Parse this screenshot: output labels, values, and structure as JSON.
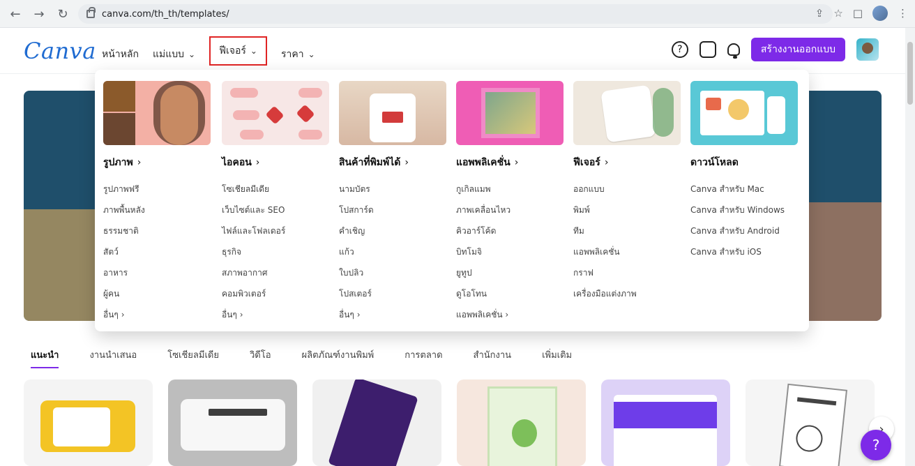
{
  "browser": {
    "url": "canva.com/th_th/templates/",
    "back_icon": "←",
    "forward_icon": "→",
    "refresh_icon": "↻",
    "share_icon": "⇪",
    "star_icon": "☆",
    "window_icon": "□",
    "menu_icon": "⋮"
  },
  "header": {
    "logo": "Canva",
    "nav": [
      {
        "label": "หน้าหลัก",
        "has_chevron": false
      },
      {
        "label": "แม่แบบ",
        "has_chevron": true
      },
      {
        "label": "ฟีเจอร์",
        "has_chevron": true,
        "active": true
      },
      {
        "label": "ราคา",
        "has_chevron": true
      }
    ],
    "help_icon": "?",
    "create_label": "สร้างงานออกแบบ"
  },
  "mega_menu": {
    "columns": [
      {
        "title": "รูปภาพ",
        "links": [
          "รูปภาพฟรี",
          "ภาพพื้นหลัง",
          "ธรรมชาติ",
          "สัตว์",
          "อาหาร",
          "ผู้คน",
          "อื่นๆ"
        ]
      },
      {
        "title": "ไอคอน",
        "links": [
          "โซเชียลมีเดีย",
          "เว็บไซต์และ SEO",
          "ไฟล์และโฟลเดอร์",
          "ธุรกิจ",
          "สภาพอากาศ",
          "คอมพิวเตอร์",
          "อื่นๆ"
        ]
      },
      {
        "title": "สินค้าที่พิมพ์ได้",
        "links": [
          "นามบัตร",
          "โปสการ์ด",
          "คำเชิญ",
          "แก้ว",
          "ใบปลิว",
          "โปสเตอร์",
          "อื่นๆ"
        ]
      },
      {
        "title": "แอพพลิเคชั่น",
        "links": [
          "กูเกิลแมพ",
          "ภาพเคลื่อนไหว",
          "คิวอาร์โค้ด",
          "บิทโมจิ",
          "ยูทูป",
          "ดูโอโทน",
          "แอพพลิเคชั่น"
        ]
      },
      {
        "title": "ฟีเจอร์",
        "links": [
          "ออกแบบ",
          "พิมพ์",
          "ทีม",
          "แอพพลิเคชั่น",
          "กราฟ",
          "เครื่องมือแต่งภาพ"
        ]
      },
      {
        "title": "ดาวน์โหลด",
        "links": [
          "Canva สำหรับ Mac",
          "Canva สำหรับ Windows",
          "Canva สำหรับ Android",
          "Canva สำหรับ iOS"
        ]
      }
    ]
  },
  "tabs": [
    "แนะนำ",
    "งานนำเสนอ",
    "โซเชียลมีเดีย",
    "วิดีโอ",
    "ผลิตภัณฑ์งานพิมพ์",
    "การตลาด",
    "สำนักงาน",
    "เพิ่มเติม"
  ],
  "next_icon": "›",
  "fab_icon": "?"
}
